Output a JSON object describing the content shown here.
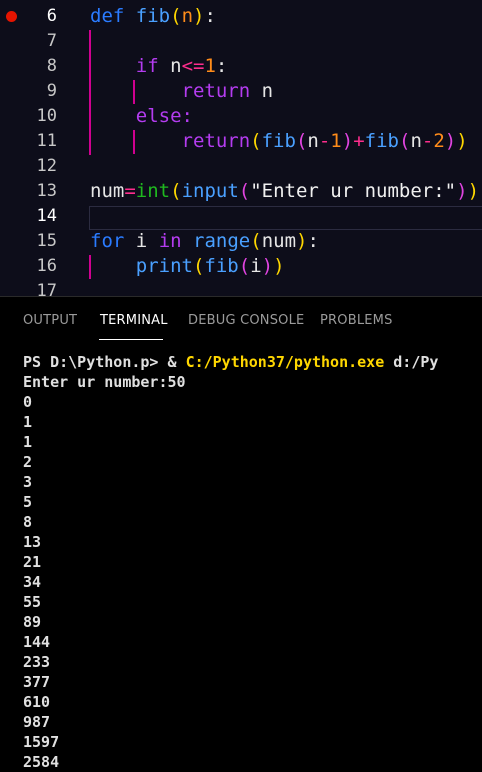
{
  "editor": {
    "line_numbers": [
      "6",
      "7",
      "8",
      "9",
      "10",
      "11",
      "12",
      "13",
      "14",
      "15",
      "16",
      "17"
    ],
    "code": {
      "l6": {
        "kw": "def",
        "name": "fib",
        "open": "(",
        "param": "n",
        "close": ")",
        "colon": ":"
      },
      "l8": {
        "kw": "if",
        "var": "n",
        "op": "<=",
        "num": "1",
        "colon": ":"
      },
      "l9": {
        "kw": "return",
        "var": "n"
      },
      "l10": {
        "kw": "else:"
      },
      "l11": {
        "kw": "return",
        "o1": "(",
        "fn1": "fib",
        "o2": "(",
        "a1": "n",
        "op1": "-",
        "n1": "1",
        "c2": ")",
        "plus": "+",
        "fn2": "fib",
        "o3": "(",
        "a2": "n",
        "op2": "-",
        "n2": "2",
        "c3": ")",
        "c1": ")"
      },
      "l13": {
        "var": "num",
        "eq": "=",
        "fn": "int",
        "o1": "(",
        "fn2": "input",
        "o2": "(",
        "str": "\"Enter ur number:\"",
        "c2": ")",
        "c1": ")"
      },
      "l15": {
        "kw": "for",
        "var": "i",
        "in": "in",
        "fn": "range",
        "o": "(",
        "arg": "num",
        "c": ")",
        "colon": ":"
      },
      "l16": {
        "fn": "print",
        "o1": "(",
        "fn2": "fib",
        "o2": "(",
        "arg": "i",
        "c2": ")",
        "c1": ")"
      }
    }
  },
  "panel": {
    "tabs": [
      "OUTPUT",
      "TERMINAL",
      "DEBUG CONSOLE",
      "PROBLEMS"
    ],
    "active_tab": "TERMINAL"
  },
  "terminal": {
    "prompt": "PS D:\\Python.p> & ",
    "exe": "C:/Python37/python.exe",
    "arg": " d:/Py",
    "input_line": "Enter ur number:50",
    "output": [
      "0",
      "1",
      "1",
      "2",
      "3",
      "5",
      "8",
      "13",
      "21",
      "34",
      "55",
      "89",
      "144",
      "233",
      "377",
      "610",
      "987",
      "1597",
      "2584"
    ]
  },
  "colors": {
    "breakpoint": "#e51400",
    "keyword": "#2a7bff",
    "exe_path": "#ffd700"
  }
}
